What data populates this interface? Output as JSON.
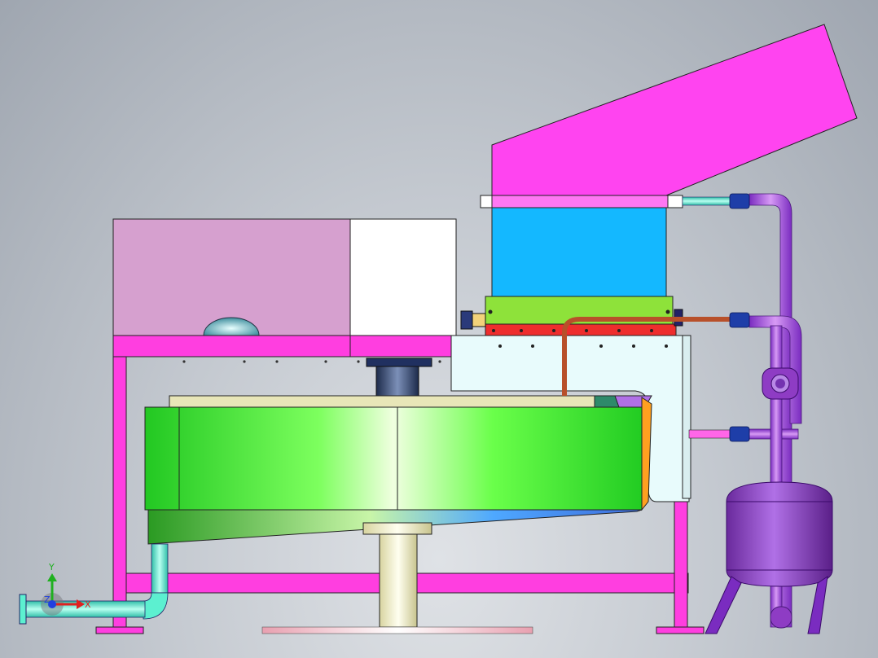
{
  "scene": {
    "colors": {
      "frame": "#ff3ee0",
      "hopper": "#ff44f0",
      "hopper_window": "#14b8ff",
      "motor_box": "#d6a0cf",
      "motor_face": "#ffffff",
      "drum": "#33ee33",
      "housing": "#e8fbfc",
      "pipe_cyan": "#5cf0d0",
      "pipe_violet": "#a34be0",
      "tank": "#8e3cc4",
      "fitting_blue": "#1e3ea8",
      "copper_pipe": "#b8502a",
      "heater_green": "#8ee23a",
      "heater_red": "#ee2d2d",
      "pedestal": "#f2f0c8"
    },
    "parts": [
      "hopper-chute",
      "hopper-window",
      "motor-housing",
      "gearbox-cover",
      "support-frame",
      "rotor-drum",
      "side-housing",
      "heater-band",
      "coolant-manifold",
      "expansion-tank",
      "inlet-pipe",
      "pedestal"
    ]
  },
  "triad": {
    "x_label": "X",
    "y_label": "Y",
    "z_label": "Z",
    "x_color": "#e02020",
    "y_color": "#20b020",
    "z_color": "#2040e0"
  }
}
